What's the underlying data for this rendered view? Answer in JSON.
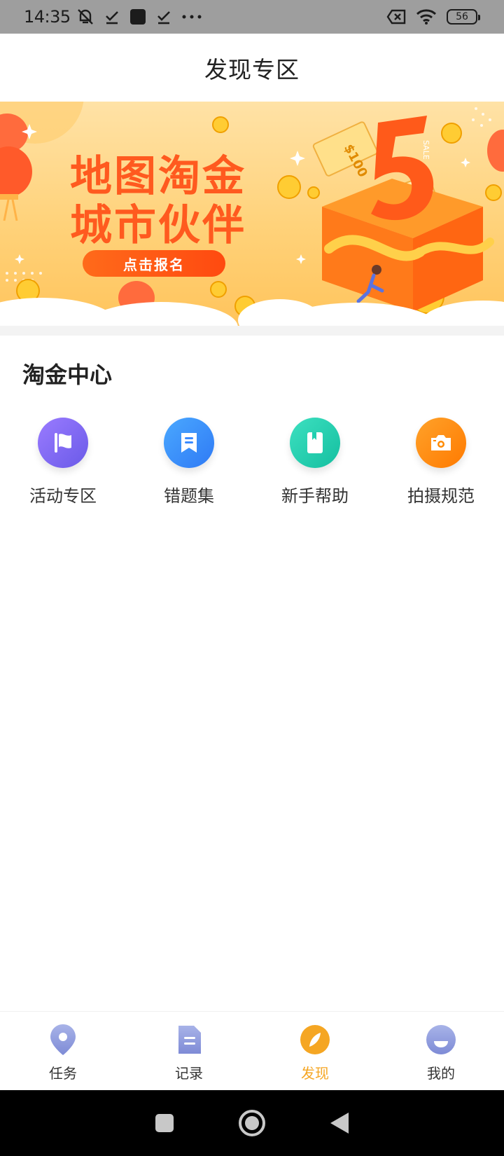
{
  "status_bar": {
    "time": "14:35",
    "battery": "56"
  },
  "header": {
    "title": "发现专区"
  },
  "banner": {
    "line1": "地图淘金",
    "line2": "城市伙伴",
    "cta": "点击报名",
    "ticket_text": "$100",
    "big_number": "5",
    "sale_text": "SALE"
  },
  "section": {
    "title": "淘金中心",
    "items": [
      {
        "label": "活动专区",
        "icon": "flag-icon",
        "color": "#7a6cf0"
      },
      {
        "label": "错题集",
        "icon": "bookmark-doc-icon",
        "color": "#3b8bff"
      },
      {
        "label": "新手帮助",
        "icon": "book-icon",
        "color": "#1fcfb0"
      },
      {
        "label": "拍摄规范",
        "icon": "camera-icon",
        "color": "#ff8a00"
      }
    ]
  },
  "tabbar": {
    "items": [
      {
        "label": "任务",
        "icon": "location-pin-icon"
      },
      {
        "label": "记录",
        "icon": "document-icon"
      },
      {
        "label": "发现",
        "icon": "compass-icon",
        "active": true
      },
      {
        "label": "我的",
        "icon": "profile-icon"
      }
    ],
    "active_color": "#f5a623"
  }
}
